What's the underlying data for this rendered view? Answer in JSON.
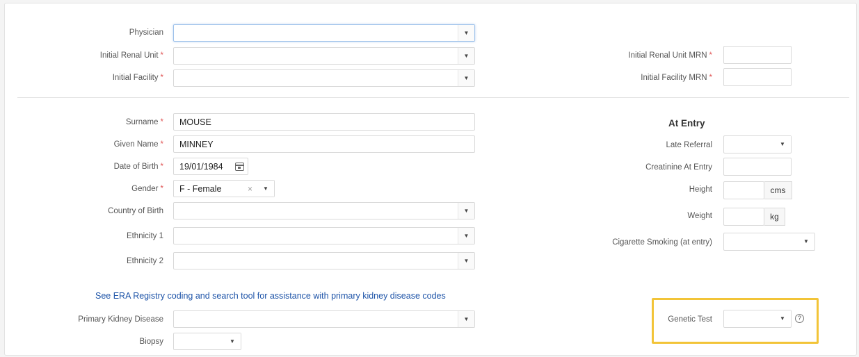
{
  "required_marker": "*",
  "physician": {
    "label": "Physician",
    "value": ""
  },
  "initial_renal_unit": {
    "label": "Initial Renal Unit",
    "value": ""
  },
  "initial_facility": {
    "label": "Initial Facility",
    "value": ""
  },
  "initial_renal_unit_mrn": {
    "label": "Initial Renal Unit MRN",
    "value": ""
  },
  "initial_facility_mrn": {
    "label": "Initial Facility MRN",
    "value": ""
  },
  "surname": {
    "label": "Surname",
    "value": "MOUSE"
  },
  "given_name": {
    "label": "Given Name",
    "value": "MINNEY"
  },
  "date_of_birth": {
    "label": "Date of Birth",
    "value": "19/01/1984"
  },
  "gender": {
    "label": "Gender",
    "value": "F - Female",
    "clear": "×"
  },
  "country_of_birth": {
    "label": "Country of Birth",
    "value": ""
  },
  "ethnicity_1": {
    "label": "Ethnicity 1",
    "value": ""
  },
  "ethnicity_2": {
    "label": "Ethnicity 2",
    "value": ""
  },
  "era_link": "See ERA Registry coding and search tool for assistance with primary kidney disease codes",
  "primary_kidney_disease": {
    "label": "Primary Kidney Disease",
    "value": ""
  },
  "biopsy": {
    "label": "Biopsy",
    "value": ""
  },
  "at_entry": {
    "title": "At Entry",
    "late_referral": {
      "label": "Late Referral",
      "value": ""
    },
    "creatinine": {
      "label": "Creatinine At Entry",
      "value": ""
    },
    "height": {
      "label": "Height",
      "value": "",
      "unit": "cms"
    },
    "weight": {
      "label": "Weight",
      "value": "",
      "unit": "kg"
    },
    "smoking": {
      "label": "Cigarette Smoking (at entry)",
      "value": ""
    }
  },
  "genetic_test": {
    "label": "Genetic Test",
    "value": "",
    "help": "?"
  },
  "icons": {
    "dropdown": "▼",
    "calendar": "calendar-icon"
  },
  "colors": {
    "required": "#e05555",
    "link": "#1e54a8",
    "highlight": "#f2c438",
    "focus": "#9ec2ea"
  }
}
